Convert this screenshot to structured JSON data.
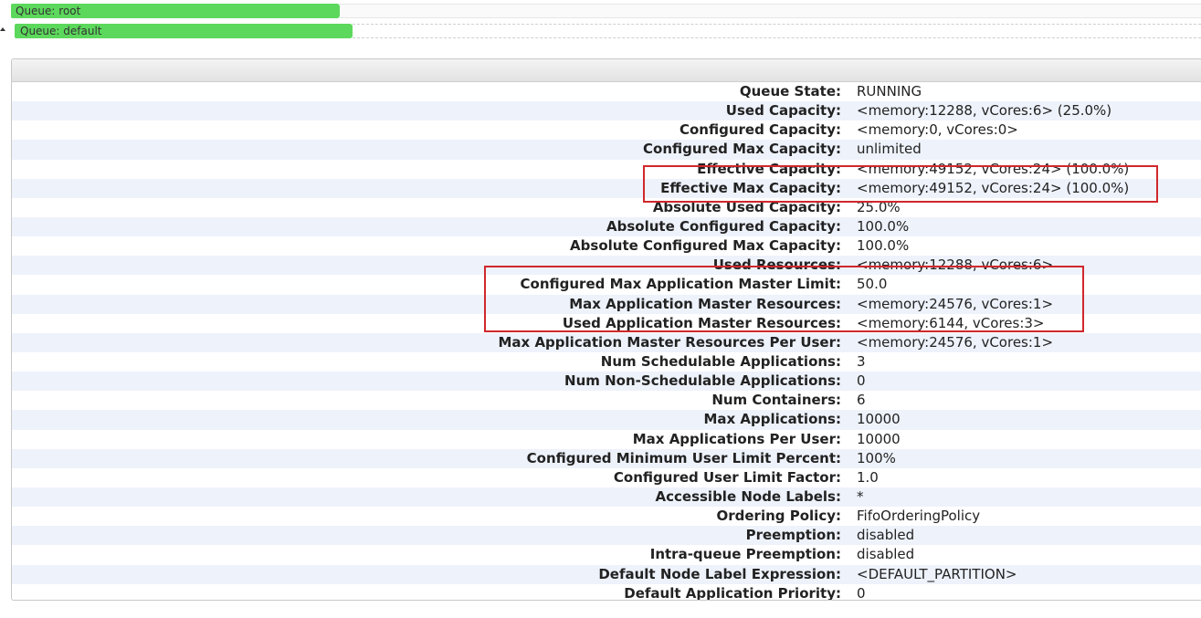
{
  "queues": {
    "root": {
      "label": "Queue: root"
    },
    "default": {
      "label": "Queue: default"
    }
  },
  "colors": {
    "queue_fill": "#5cd85c",
    "row_alt": "#eef2fb",
    "highlight": "#d0282c"
  },
  "details": [
    {
      "key": "Queue State:",
      "value": "RUNNING"
    },
    {
      "key": "Used Capacity:",
      "value": "<memory:12288, vCores:6> (25.0%)"
    },
    {
      "key": "Configured Capacity:",
      "value": "<memory:0, vCores:0>"
    },
    {
      "key": "Configured Max Capacity:",
      "value": "unlimited"
    },
    {
      "key": "Effective Capacity:",
      "value": "<memory:49152, vCores:24> (100.0%)"
    },
    {
      "key": "Effective Max Capacity:",
      "value": "<memory:49152, vCores:24> (100.0%)"
    },
    {
      "key": "Absolute Used Capacity:",
      "value": "25.0%"
    },
    {
      "key": "Absolute Configured Capacity:",
      "value": "100.0%"
    },
    {
      "key": "Absolute Configured Max Capacity:",
      "value": "100.0%"
    },
    {
      "key": "Used Resources:",
      "value": "<memory:12288, vCores:6>"
    },
    {
      "key": "Configured Max Application Master Limit:",
      "value": "50.0"
    },
    {
      "key": "Max Application Master Resources:",
      "value": "<memory:24576, vCores:1>"
    },
    {
      "key": "Used Application Master Resources:",
      "value": "<memory:6144, vCores:3>"
    },
    {
      "key": "Max Application Master Resources Per User:",
      "value": "<memory:24576, vCores:1>"
    },
    {
      "key": "Num Schedulable Applications:",
      "value": "3"
    },
    {
      "key": "Num Non-Schedulable Applications:",
      "value": "0"
    },
    {
      "key": "Num Containers:",
      "value": "6"
    },
    {
      "key": "Max Applications:",
      "value": "10000"
    },
    {
      "key": "Max Applications Per User:",
      "value": "10000"
    },
    {
      "key": "Configured Minimum User Limit Percent:",
      "value": "100%"
    },
    {
      "key": "Configured User Limit Factor:",
      "value": "1.0"
    },
    {
      "key": "Accessible Node Labels:",
      "value": "*"
    },
    {
      "key": "Ordering Policy:",
      "value": "FifoOrderingPolicy"
    },
    {
      "key": "Preemption:",
      "value": "disabled"
    },
    {
      "key": "Intra-queue Preemption:",
      "value": "disabled"
    },
    {
      "key": "Default Node Label Expression:",
      "value": "<DEFAULT_PARTITION>"
    },
    {
      "key": "Default Application Priority:",
      "value": "0"
    }
  ]
}
